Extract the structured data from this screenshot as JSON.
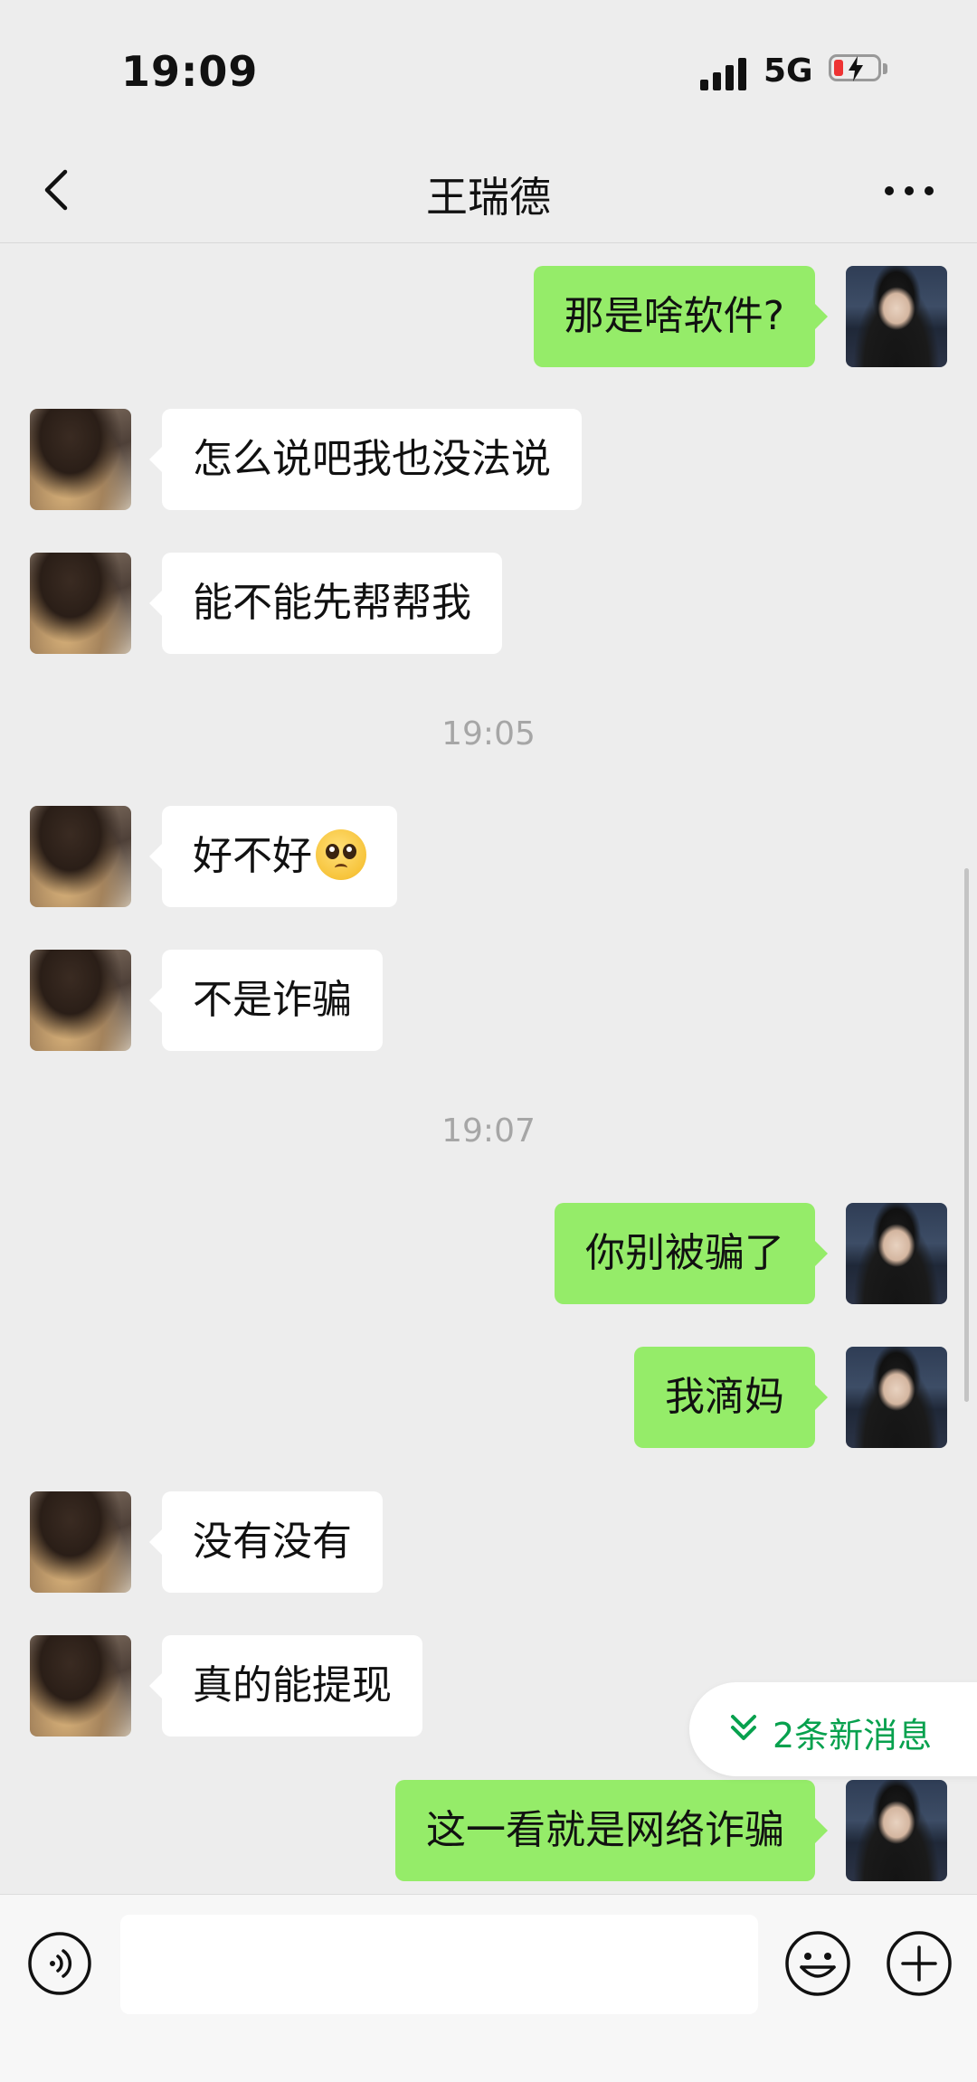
{
  "status_bar": {
    "time": "19:09",
    "network": "5G"
  },
  "header": {
    "title": "王瑞德"
  },
  "messages": [
    {
      "from": "me",
      "text": "那是啥软件?"
    },
    {
      "from": "them",
      "text": "怎么说吧我也没法说"
    },
    {
      "from": "them",
      "text": "能不能先帮帮我"
    },
    {
      "type": "time",
      "text": "19:05"
    },
    {
      "from": "them",
      "text": "好不好",
      "emoji": "pleading-face"
    },
    {
      "from": "them",
      "text": "不是诈骗"
    },
    {
      "type": "time",
      "text": "19:07"
    },
    {
      "from": "me",
      "text": "你别被骗了"
    },
    {
      "from": "me",
      "text": "我滴妈"
    },
    {
      "from": "them",
      "text": "没有没有"
    },
    {
      "from": "them",
      "text": "真的能提现"
    },
    {
      "from": "me",
      "text": "这一看就是网络诈骗"
    }
  ],
  "new_messages_pill": {
    "label": "2条新消息"
  },
  "input_bar": {
    "value": "",
    "placeholder": ""
  },
  "colors": {
    "background": "#EDEDED",
    "my_bubble": "#95EC69",
    "their_bubble": "#FFFFFF",
    "accent_green": "#07A14E"
  }
}
